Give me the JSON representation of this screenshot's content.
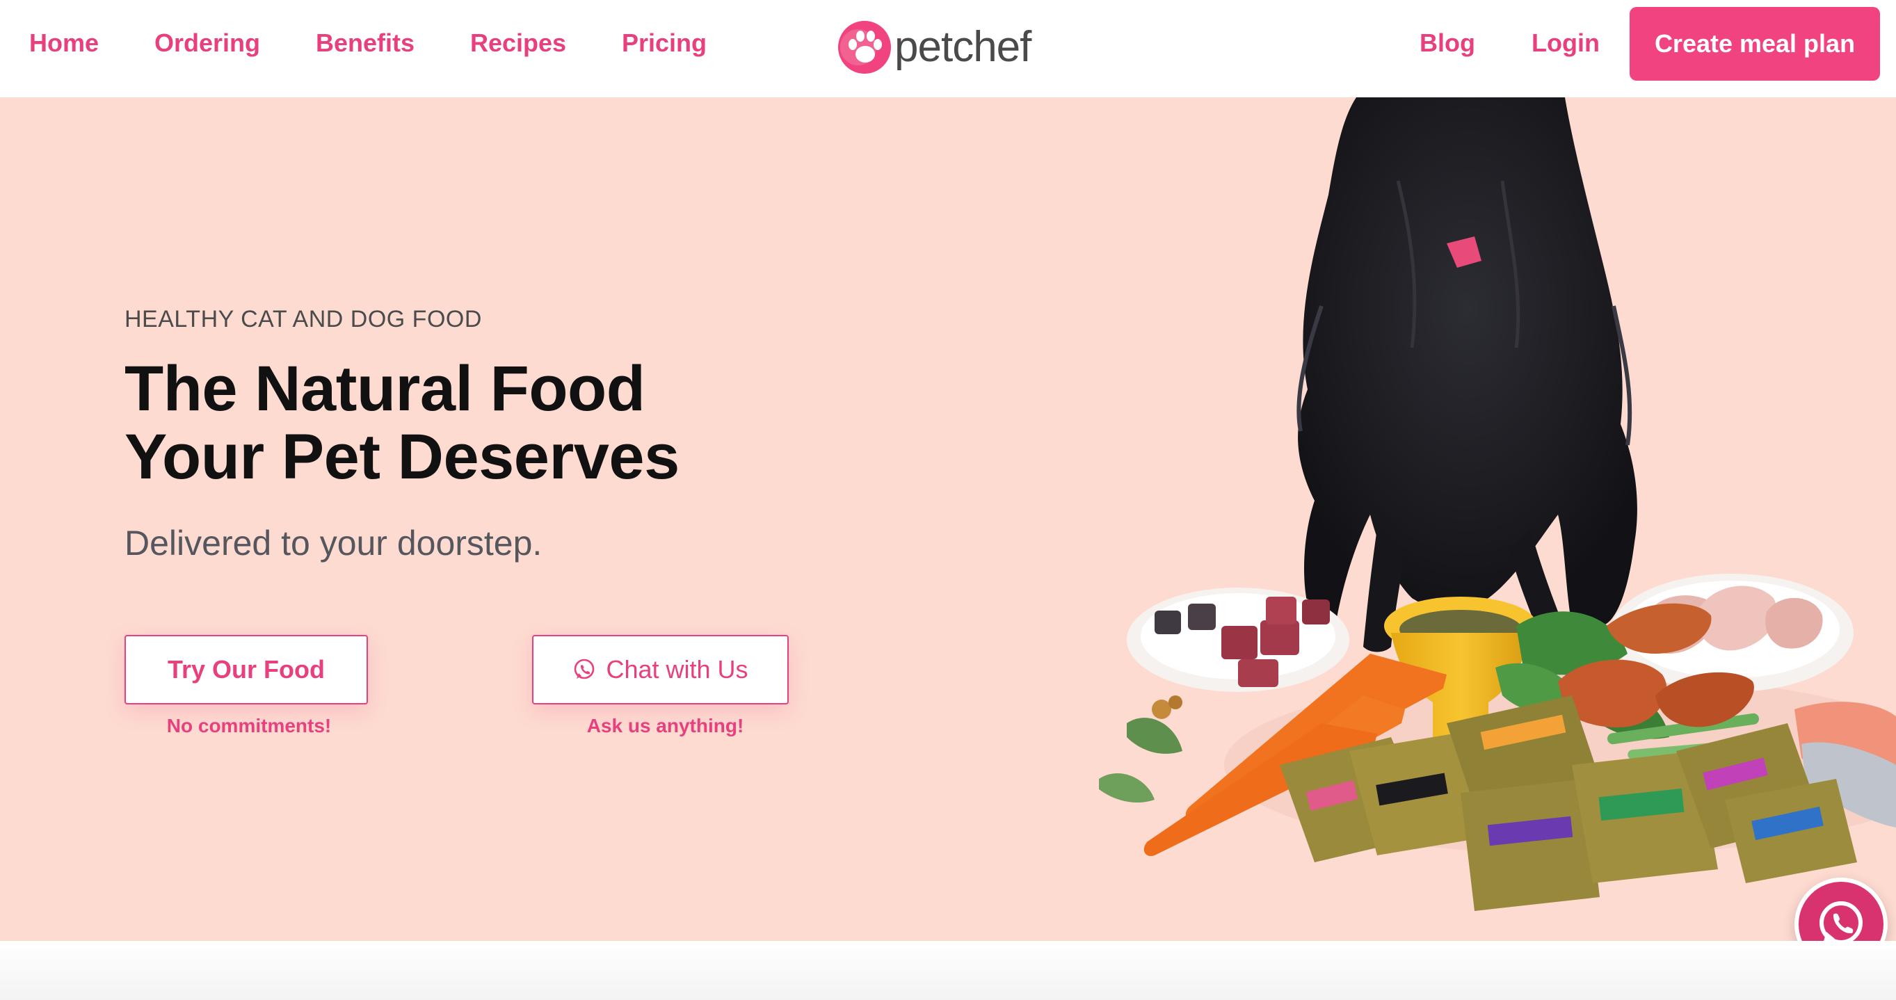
{
  "nav": {
    "left_links": [
      "Home",
      "Ordering",
      "Benefits",
      "Recipes",
      "Pricing"
    ],
    "brand": "petchef",
    "right_links": [
      "Blog",
      "Login"
    ],
    "cta_label": "Create meal plan"
  },
  "hero": {
    "eyebrow": "HEALTHY CAT AND DOG FOOD",
    "headline_line1": "The Natural Food",
    "headline_line2": "Your Pet Deserves",
    "subline": "Delivered to your doorstep.",
    "primary_button": "Try Our Food",
    "primary_note": "No commitments!",
    "secondary_button": "Chat with Us",
    "secondary_note": "Ask us anything!",
    "image_icon": "dog-eating-food-photo"
  },
  "floating": {
    "icon": "whatsapp-icon"
  },
  "colors": {
    "brand_pink": "#e8407e",
    "hero_background": "#fddbd1",
    "cta_background": "#f0437f"
  }
}
